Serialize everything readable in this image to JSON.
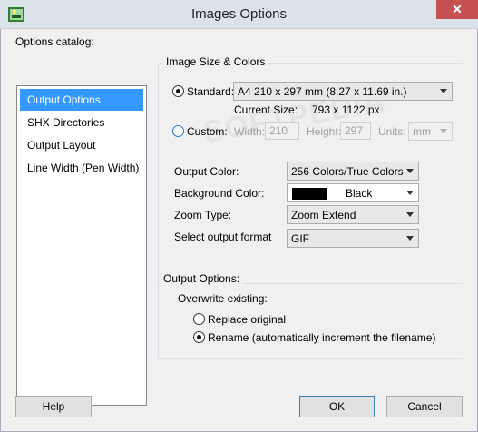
{
  "window": {
    "title": "Images Options",
    "close_glyph": "✕",
    "app_icon": "image-app-icon"
  },
  "catalog": {
    "label": "Options catalog:",
    "items": [
      {
        "label": "Output Options",
        "selected": true
      },
      {
        "label": "SHX Directories",
        "selected": false
      },
      {
        "label": "Output Layout",
        "selected": false
      },
      {
        "label": "Line Width (Pen Width)",
        "selected": false
      }
    ]
  },
  "size_group": {
    "title": "Image Size & Colors",
    "standard_label": "Standard:",
    "standard_value": "A4 210 x 297 mm (8.27 x 11.69 in.)",
    "current_size_label": "Current Size:",
    "current_size_value": "793 x 1122 px",
    "custom_label": "Custom:",
    "width_label": "Width:",
    "width_value": "210",
    "height_label": "Height:",
    "height_value": "297",
    "units_label": "Units:",
    "units_value": "mm",
    "output_color_label": "Output Color:",
    "output_color_value": "256 Colors/True Colors",
    "background_color_label": "Background Color:",
    "background_color_value": "Black",
    "background_color_swatch": "#000000",
    "zoom_type_label": "Zoom Type:",
    "zoom_type_value": "Zoom Extend",
    "format_label": "Select output format",
    "format_value": "GIF"
  },
  "output_options": {
    "title": "Output Options:",
    "overwrite_label": "Overwrite existing:",
    "replace_label": "Replace original",
    "rename_label": "Rename (automatically increment the filename)"
  },
  "buttons": {
    "help": "Help",
    "ok": "OK",
    "cancel": "Cancel"
  },
  "watermark": "SOFTPEDIA"
}
